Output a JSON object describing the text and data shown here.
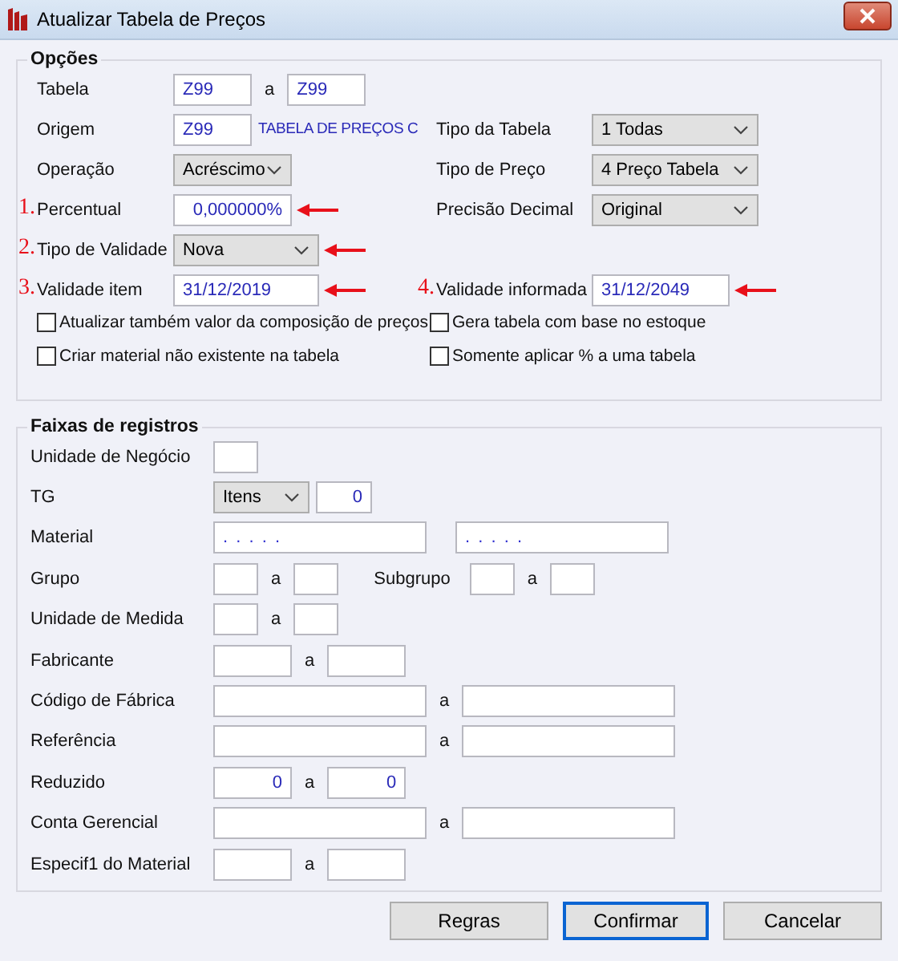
{
  "window": {
    "title": "Atualizar Tabela de Preços"
  },
  "options": {
    "legend": "Opções",
    "rows": [
      {
        "cells": [
          {
            "label": "Tabela",
            "kind": "range",
            "from": "Z99",
            "sep": "a",
            "to": "Z99"
          }
        ]
      },
      {
        "cells": [
          {
            "label": "Origem",
            "kind": "input",
            "value": "Z99",
            "description": "TABELA DE PREÇOS C"
          },
          {
            "label": "Tipo da Tabela",
            "kind": "select",
            "value": "1 Todas"
          }
        ]
      },
      {
        "cells": [
          {
            "label": "Operação",
            "kind": "select",
            "value": "Acréscimo"
          },
          {
            "label": "Tipo de Preço",
            "kind": "select",
            "value": "4 Preço Tabela"
          }
        ]
      },
      {
        "cells": [
          {
            "marker": "1.",
            "label": "Percentual",
            "kind": "number",
            "value": "0,000000%"
          },
          {
            "label": "Precisão Decimal",
            "kind": "select",
            "value": "Original"
          }
        ]
      },
      {
        "cells": [
          {
            "marker": "2.",
            "label": "Tipo de Validade",
            "kind": "select",
            "value": "Nova"
          }
        ]
      },
      {
        "cells": [
          {
            "marker": "3.",
            "label": "Validade item",
            "kind": "input",
            "value": "31/12/2019"
          },
          {
            "marker": "4.",
            "label": "Validade informada",
            "kind": "input",
            "value": "31/12/2049"
          }
        ]
      }
    ],
    "checkboxes": [
      {
        "label": "Atualizar também valor da composição de preços",
        "checked": false
      },
      {
        "label": "Gera tabela com base no estoque",
        "checked": false
      },
      {
        "label": "Criar material não existente na tabela",
        "checked": false
      },
      {
        "label": "Somente aplicar % a uma tabela",
        "checked": false
      }
    ]
  },
  "ranges": {
    "legend": "Faixas de registros",
    "rows": [
      {
        "label": "Unidade de Negócio",
        "parts": [
          {
            "kind": "input"
          }
        ]
      },
      {
        "label": "TG",
        "parts": [
          {
            "kind": "select",
            "value": "Itens"
          },
          {
            "kind": "number",
            "value": "0"
          }
        ]
      },
      {
        "label": "Material",
        "parts": [
          {
            "kind": "input",
            "value": ". . . . ."
          },
          {
            "kind": "input",
            "value": ". . . . ."
          }
        ]
      },
      {
        "label": "Grupo",
        "parts": [
          {
            "kind": "input"
          },
          {
            "kind": "sep",
            "text": "a"
          },
          {
            "kind": "input"
          },
          {
            "kind": "label",
            "text": "Subgrupo"
          },
          {
            "kind": "input"
          },
          {
            "kind": "sep",
            "text": "a"
          },
          {
            "kind": "input"
          }
        ]
      },
      {
        "label": "Unidade de Medida",
        "parts": [
          {
            "kind": "input"
          },
          {
            "kind": "sep",
            "text": "a"
          },
          {
            "kind": "input"
          }
        ]
      },
      {
        "label": "Fabricante",
        "parts": [
          {
            "kind": "input"
          },
          {
            "kind": "sep",
            "text": "a"
          },
          {
            "kind": "input"
          }
        ]
      },
      {
        "label": "Código de Fábrica",
        "parts": [
          {
            "kind": "input"
          },
          {
            "kind": "sep",
            "text": "a"
          },
          {
            "kind": "input"
          }
        ]
      },
      {
        "label": "Referência",
        "parts": [
          {
            "kind": "input"
          },
          {
            "kind": "sep",
            "text": "a"
          },
          {
            "kind": "input"
          }
        ]
      },
      {
        "label": "Reduzido",
        "parts": [
          {
            "kind": "number",
            "value": "0"
          },
          {
            "kind": "sep",
            "text": "a"
          },
          {
            "kind": "number",
            "value": "0"
          }
        ]
      },
      {
        "label": "Conta Gerencial",
        "parts": [
          {
            "kind": "input"
          },
          {
            "kind": "sep",
            "text": "a"
          },
          {
            "kind": "input"
          }
        ]
      },
      {
        "label": "Especif1 do Material",
        "parts": [
          {
            "kind": "input"
          },
          {
            "kind": "sep",
            "text": "a"
          },
          {
            "kind": "input"
          }
        ]
      }
    ]
  },
  "buttons": [
    {
      "label": "Regras",
      "focused": false
    },
    {
      "label": "Confirmar",
      "focused": true
    },
    {
      "label": "Cancelar",
      "focused": false
    }
  ]
}
